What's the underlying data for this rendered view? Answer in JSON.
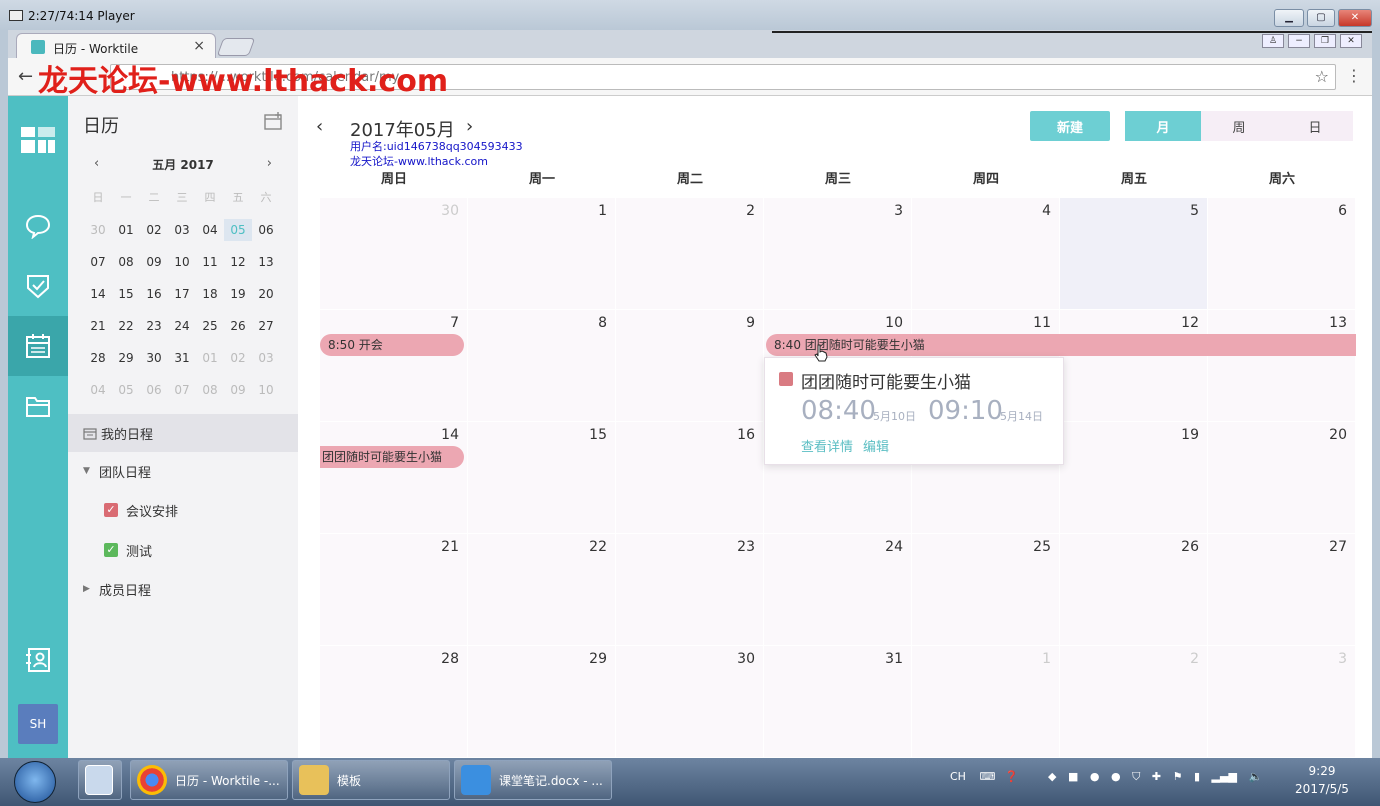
{
  "player": {
    "title": "2:27/74:14 Player"
  },
  "browser": {
    "tab_title": "日历 - Worktile",
    "tab_close": "×",
    "url": "https://...worktile.com/calendar/my",
    "watermark": "龙天论坛-www.lthack.com"
  },
  "rail": {
    "avatar": "SH"
  },
  "sidebar": {
    "title": "日历",
    "mini_title": "五月 2017",
    "prev": "‹",
    "next": "›",
    "weekdays": [
      "日",
      "一",
      "二",
      "三",
      "四",
      "五",
      "六"
    ],
    "weeks": [
      [
        "30",
        "01",
        "02",
        "03",
        "04",
        "05",
        "06"
      ],
      [
        "07",
        "08",
        "09",
        "10",
        "11",
        "12",
        "13"
      ],
      [
        "14",
        "15",
        "16",
        "17",
        "18",
        "19",
        "20"
      ],
      [
        "21",
        "22",
        "23",
        "24",
        "25",
        "26",
        "27"
      ],
      [
        "28",
        "29",
        "30",
        "31",
        "01",
        "02",
        "03"
      ],
      [
        "04",
        "05",
        "06",
        "07",
        "08",
        "09",
        "10"
      ]
    ],
    "my_schedule": "我的日程",
    "team_schedule": "团队日程",
    "team_items": [
      {
        "label": "会议安排",
        "color": "#d96b73"
      },
      {
        "label": "测试",
        "color": "#5cb85c"
      }
    ],
    "member_schedule": "成员日程"
  },
  "main": {
    "title": "2017年05月",
    "prev": "‹",
    "next": "›",
    "watermark_user": "用户名:uid146738qq304593433",
    "watermark_site": "龙天论坛-www.lthack.com",
    "new_button": "新建",
    "views": [
      "月",
      "周",
      "日"
    ],
    "active_view": "月",
    "weekdays": [
      "周日",
      "周一",
      "周二",
      "周三",
      "周四",
      "周五",
      "周六"
    ],
    "weeks": [
      [
        "30",
        "1",
        "2",
        "3",
        "4",
        "5",
        "6"
      ],
      [
        "7",
        "8",
        "9",
        "10",
        "11",
        "12",
        "13"
      ],
      [
        "14",
        "15",
        "16",
        "17",
        "18",
        "19",
        "20"
      ],
      [
        "21",
        "22",
        "23",
        "24",
        "25",
        "26",
        "27"
      ],
      [
        "28",
        "29",
        "30",
        "31",
        "1",
        "2",
        "3"
      ]
    ],
    "events": [
      {
        "label": "8:50 开会"
      },
      {
        "label": "8:40 团团随时可能要生小猫"
      },
      {
        "label": "团团随时可能要生小猫"
      }
    ],
    "popup": {
      "title": "团团随时可能要生小猫",
      "start_time": "08:40",
      "start_date": "5月10日",
      "end_time": "09:10",
      "end_date": "5月14日",
      "details_link": "查看详情",
      "edit_link": "编辑"
    }
  },
  "taskbar": {
    "apps": [
      "日历 - Worktile -...",
      "模板",
      "课堂笔记.docx - ..."
    ],
    "lang": "CH",
    "time": "9:29",
    "date": "2017/5/5"
  },
  "colors": {
    "accent": "#4ebfc3",
    "event": "#eca7b2",
    "today_bg": "#f0f0f8"
  }
}
